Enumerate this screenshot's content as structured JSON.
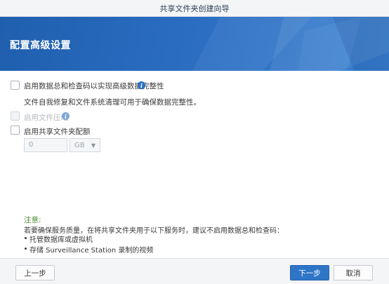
{
  "window": {
    "title": "共享文件夹创建向导"
  },
  "banner": {
    "title": "配置高级设置"
  },
  "options": {
    "checksum": {
      "label": "启用数据总和检查码以实现高级数据完整性",
      "description": "文件自我修复和文件系统清理可用于确保数据完整性。",
      "checked": false
    },
    "compression": {
      "label": "启用文件压缩",
      "checked": false,
      "disabled": true
    },
    "quota": {
      "label": "启用共享文件夹配额",
      "checked": false
    }
  },
  "quota_input": {
    "value": "0",
    "unit": "GB"
  },
  "note": {
    "title": "注意:",
    "body": "若要确保服务质量，在将共享文件夹用于以下服务时，建议不启用数据总和检查码：",
    "items": [
      "托管数据库或虚拟机",
      "存储 Surveillance Station 录制的视频"
    ]
  },
  "footer": {
    "prev_label": "上一步",
    "next_label": "下一步",
    "cancel_label": "取消"
  },
  "colors": {
    "accent": "#2f75c7",
    "banner": "#2a6cc0",
    "note_title": "#4a8a2f"
  },
  "icons": {
    "info": "info-icon",
    "dropdown": "chevron-down-icon"
  }
}
